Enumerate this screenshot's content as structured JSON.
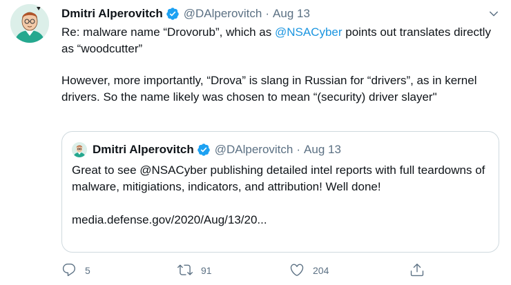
{
  "tweet": {
    "author": {
      "name": "Dmitri Alperovitch",
      "handle": "@DAlperovitch",
      "verified": true
    },
    "separator": "·",
    "date": "Aug 13",
    "paragraph1": {
      "before": "Re: malware name “Drovorub”, which as ",
      "mention": "@NSACyber",
      "after": " points out translates directly as “woodcutter”"
    },
    "paragraph2": "However, more importantly, “Drova” is slang in Russian for “drivers”, as in kernel drivers. So the name likely was chosen to mean “(security) driver slayer\"",
    "quoted": {
      "author": {
        "name": "Dmitri Alperovitch",
        "handle": "@DAlperovitch",
        "verified": true
      },
      "date": "Aug 13",
      "text": "Great to see @NSACyber publishing detailed intel reports with full teardowns of malware, mitigiations, indicators, and attribution! Well done!",
      "link": "media.defense.gov/2020/Aug/13/20..."
    },
    "actions": {
      "reply": {
        "icon": "reply-icon",
        "count": "5"
      },
      "retweet": {
        "icon": "retweet-icon",
        "count": "91"
      },
      "like": {
        "icon": "heart-icon",
        "count": "204"
      },
      "share": {
        "icon": "share-icon"
      }
    }
  },
  "colors": {
    "text": "#0f1419",
    "secondary": "#5b7083",
    "link": "#1b95e0",
    "verified": "#1da1f2",
    "border": "#cfd9de"
  }
}
